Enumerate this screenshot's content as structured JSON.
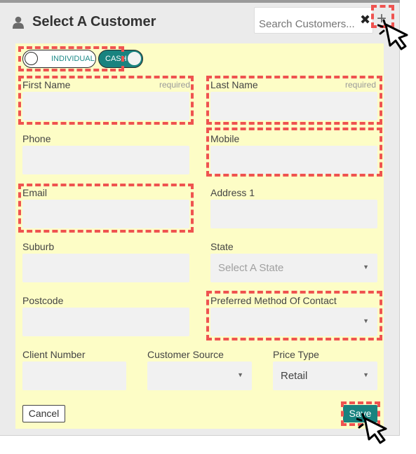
{
  "header": {
    "title": "Select A Customer",
    "search_placeholder": "Search Customers...",
    "clear_icon": "close-icon",
    "add_icon": "plus-icon",
    "user_icon": "user-icon"
  },
  "toggles": {
    "type_label": "INDIVIDUAL",
    "payment_label": "CASH"
  },
  "fields": {
    "first_name": "First Name",
    "first_name_req": "required",
    "last_name": "Last Name",
    "last_name_req": "required",
    "phone": "Phone",
    "mobile": "Mobile",
    "email": "Email",
    "address1": "Address 1",
    "suburb": "Suburb",
    "state": "State",
    "state_placeholder": "Select A State",
    "postcode": "Postcode",
    "preferred_contact": "Preferred Method Of Contact",
    "preferred_contact_value": "",
    "client_number": "Client Number",
    "customer_source": "Customer Source",
    "customer_source_value": "",
    "price_type": "Price Type",
    "price_type_value": "Retail"
  },
  "buttons": {
    "cancel": "Cancel",
    "save": "Save"
  },
  "colors": {
    "accent": "#19837f",
    "form_bg": "#fdfdc6",
    "highlight": "#ef5350"
  }
}
